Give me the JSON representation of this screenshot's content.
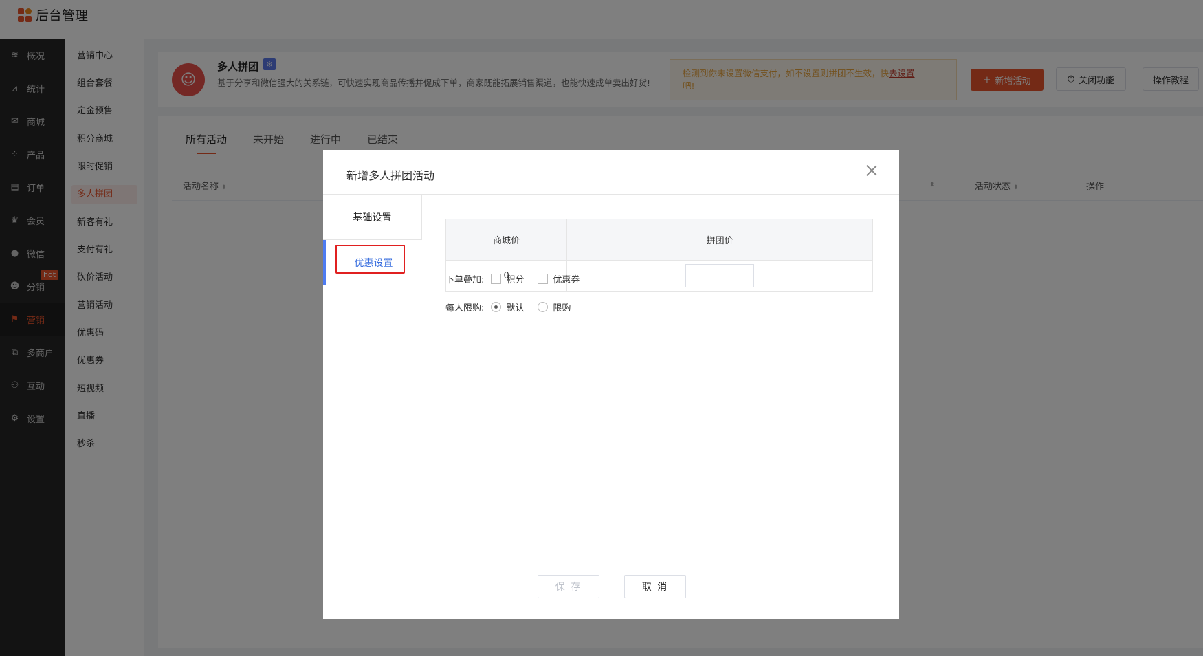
{
  "app": {
    "title": "后台管理"
  },
  "nav": [
    {
      "label": "概况",
      "icon": "layers-icon"
    },
    {
      "label": "统计",
      "icon": "chart-icon"
    },
    {
      "label": "商城",
      "icon": "mail-icon"
    },
    {
      "label": "产品",
      "icon": "grid-icon"
    },
    {
      "label": "订单",
      "icon": "clipboard-icon"
    },
    {
      "label": "会员",
      "icon": "crown-icon"
    },
    {
      "label": "微信",
      "icon": "wechat-icon"
    },
    {
      "label": "分销",
      "icon": "user-icon"
    },
    {
      "label": "营销",
      "icon": "flag-icon",
      "badge": "hot"
    },
    {
      "label": "多商户",
      "icon": "store-icon"
    },
    {
      "label": "互动",
      "icon": "people-icon"
    },
    {
      "label": "设置",
      "icon": "gear-icon"
    }
  ],
  "submenu": [
    "营销中心",
    "组合套餐",
    "定金预售",
    "积分商城",
    "限时促销",
    "多人拼团",
    "新客有礼",
    "支付有礼",
    "砍价活动",
    "营销活动",
    "优惠码",
    "优惠券",
    "短视频",
    "直播",
    "秒杀"
  ],
  "header": {
    "title": "多人拼团",
    "badge": "※",
    "desc": "基于分享和微信强大的关系链，可快速实现商品传播并促成下单，商家既能拓展销售渠道，也能快速成单卖出好货!",
    "warning_text": "检测到你未设置微信支付，如不设置则拼团不生效，快",
    "warning_link": "去设置",
    "warning_tail": "吧!",
    "add_button": "新增活动",
    "close_button": "关闭功能",
    "tutorial_button": "操作教程"
  },
  "tabs": [
    "所有活动",
    "未开始",
    "进行中",
    "已结束"
  ],
  "table_headers": {
    "name": "活动名称",
    "status": "活动状态",
    "ops": "操作"
  },
  "modal": {
    "title": "新增多人拼团活动",
    "side_tabs": [
      "基础设置",
      "优惠设置"
    ],
    "price_table": {
      "headers": [
        "商城价",
        "拼团价"
      ],
      "mall_price": "0"
    },
    "stack_label": "下单叠加:",
    "stack_options": [
      "积分",
      "优惠券"
    ],
    "limit_label": "每人限购:",
    "limit_options": [
      "默认",
      "限购"
    ],
    "save_button": "保 存",
    "cancel_button": "取 消"
  },
  "colors": {
    "accent": "#e8542c",
    "tab_active": "#4e7cf2",
    "highlight": "#e02020"
  }
}
